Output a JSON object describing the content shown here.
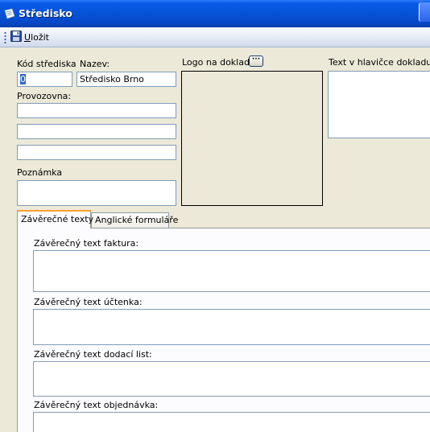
{
  "window": {
    "title": "Středisko"
  },
  "toolbar": {
    "save_label_first": "U",
    "save_label_rest": "ložit"
  },
  "form": {
    "kod_label": "Kód střediska",
    "kod_value": "0",
    "nazev_label": "Nazev:",
    "nazev_value": "Středisko Brno",
    "provozovna_label": "Provozovna:",
    "provozovna_lines": [
      "",
      "",
      ""
    ],
    "poznamka_label": "Poznámka",
    "poznamka_value": "",
    "logo_label": "Logo na doklad:",
    "logo_button_label": "···",
    "header_text_label": "Text v hlavičce dokladu:",
    "header_text_value": ""
  },
  "tabs": [
    {
      "label": "Závěrečné texty",
      "active": true
    },
    {
      "label": "Anglické formuláře",
      "active": false
    }
  ],
  "closing_texts": {
    "faktura_label": "Závěrečný text faktura:",
    "uctenka_label": "Závěrečný text účtenka:",
    "dodaci_label": "Závěrečný text dodací list:",
    "objednavka_label": "Závěrečný text objednávka:"
  }
}
